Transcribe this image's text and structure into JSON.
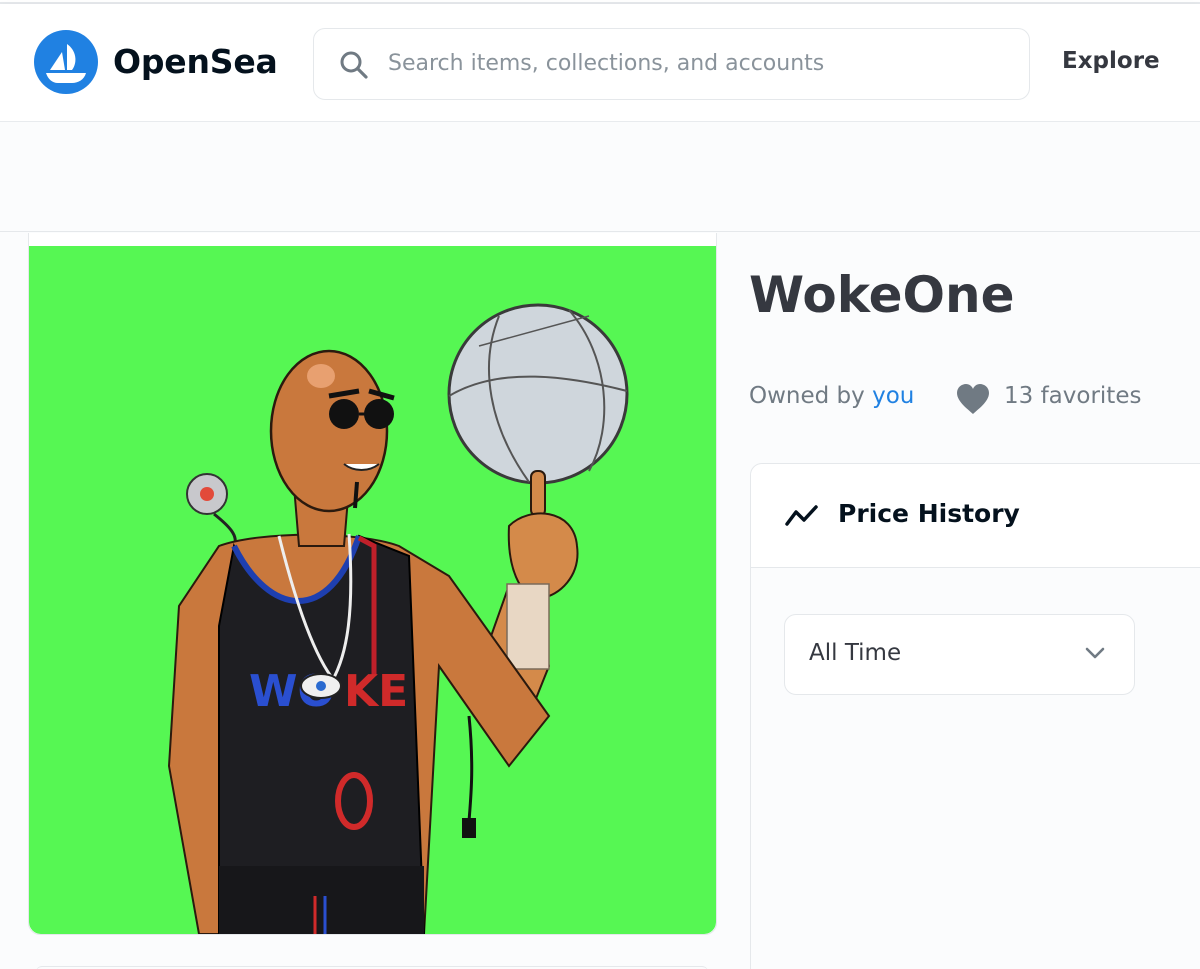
{
  "header": {
    "brand": "OpenSea",
    "search_placeholder": "Search items, collections, and accounts",
    "nav_explore": "Explore"
  },
  "item": {
    "title": "WokeOne",
    "owned_by_prefix": "Owned by",
    "owner": "you",
    "favorites": "13 favorites"
  },
  "price_history": {
    "label": "Price History",
    "range_selected": "All Time"
  },
  "colors": {
    "brand_blue": "#2081e2",
    "art_background": "#56f753"
  },
  "icons": {
    "search": "search-icon",
    "heart": "heart-icon",
    "trend": "trend-line-icon",
    "chevron": "chevron-down-icon"
  }
}
